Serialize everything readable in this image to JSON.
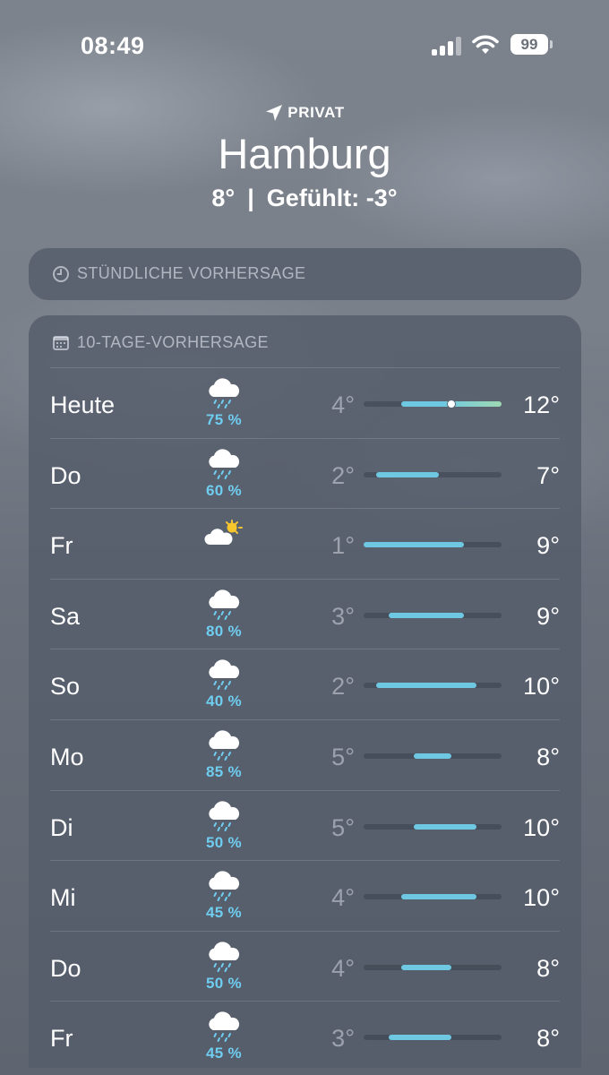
{
  "status_bar": {
    "time": "08:49",
    "battery": "99"
  },
  "location": {
    "label": "PRIVAT",
    "city": "Hamburg",
    "temperature": "8°",
    "separator": "|",
    "feels_like": "Gefühlt: -3°"
  },
  "hourly": {
    "title": "STÜNDLICHE VORHERSAGE"
  },
  "forecast": {
    "title": "10-TAGE-VORHERSAGE",
    "scale": {
      "min": 1,
      "max": 12
    },
    "days": [
      {
        "day": "Heute",
        "icon": "rain-cloud-icon",
        "precip": "75 %",
        "low": "4°",
        "high": "12°",
        "low_value": 4,
        "high_value": 12,
        "current_value": 8
      },
      {
        "day": "Do",
        "icon": "rain-cloud-icon",
        "precip": "60 %",
        "low": "2°",
        "high": "7°",
        "low_value": 2,
        "high_value": 7
      },
      {
        "day": "Fr",
        "icon": "partly-sunny-icon",
        "precip": "",
        "low": "1°",
        "high": "9°",
        "low_value": 1,
        "high_value": 9
      },
      {
        "day": "Sa",
        "icon": "rain-cloud-icon",
        "precip": "80 %",
        "low": "3°",
        "high": "9°",
        "low_value": 3,
        "high_value": 9
      },
      {
        "day": "So",
        "icon": "rain-cloud-icon",
        "precip": "40 %",
        "low": "2°",
        "high": "10°",
        "low_value": 2,
        "high_value": 10
      },
      {
        "day": "Mo",
        "icon": "rain-cloud-icon",
        "precip": "85 %",
        "low": "5°",
        "high": "8°",
        "low_value": 5,
        "high_value": 8
      },
      {
        "day": "Di",
        "icon": "rain-cloud-icon",
        "precip": "50 %",
        "low": "5°",
        "high": "10°",
        "low_value": 5,
        "high_value": 10
      },
      {
        "day": "Mi",
        "icon": "rain-cloud-icon",
        "precip": "45 %",
        "low": "4°",
        "high": "10°",
        "low_value": 4,
        "high_value": 10
      },
      {
        "day": "Do",
        "icon": "rain-cloud-icon",
        "precip": "50 %",
        "low": "4°",
        "high": "8°",
        "low_value": 4,
        "high_value": 8
      },
      {
        "day": "Fr",
        "icon": "rain-cloud-icon",
        "precip": "45 %",
        "low": "3°",
        "high": "8°",
        "low_value": 3,
        "high_value": 8
      }
    ]
  },
  "colors": {
    "temp_bar": "#6ec8e2",
    "temp_bar_warm": "#9fd9b3",
    "precip": "#6fcdf0",
    "sun": "#f7c52c"
  }
}
